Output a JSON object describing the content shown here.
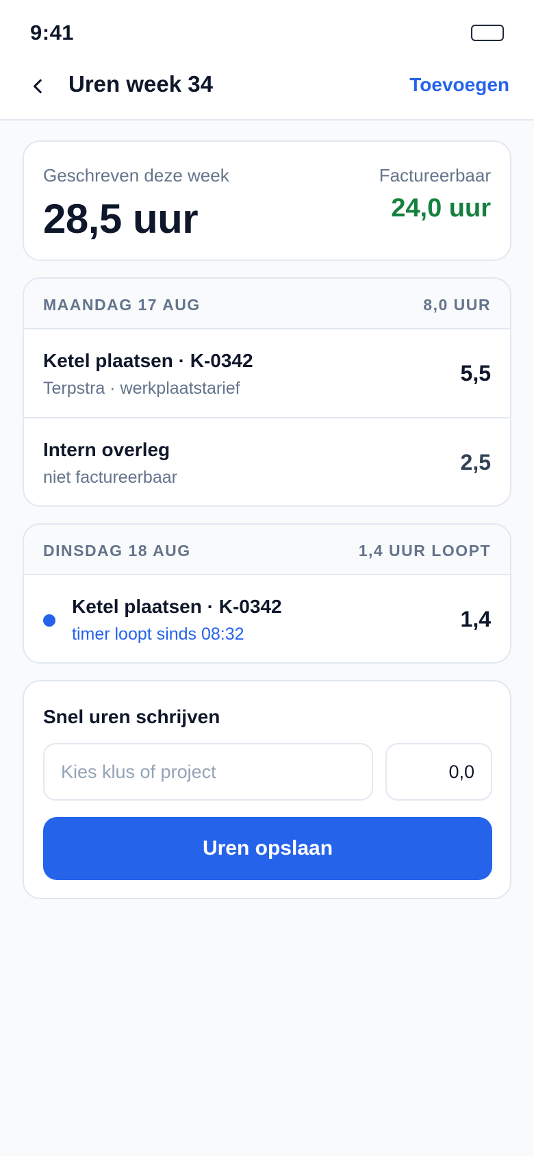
{
  "status_bar": {
    "time": "9:41",
    "battery_icon": "battery-icon"
  },
  "header": {
    "back_icon": "chevron-left-icon",
    "title": "Uren week 34",
    "action_label": "Toevoegen"
  },
  "summary": {
    "written_label": "Geschreven deze week",
    "written_value": "28,5 uur",
    "billable_label": "Factureerbaar",
    "billable_value": "24,0 uur"
  },
  "days": [
    {
      "name": "MAANDAG 17 AUG",
      "total": "8,0 UUR",
      "entries": [
        {
          "title": "Ketel plaatsen · K-0342",
          "subtitle": "Terpstra · werkplaatstarief",
          "hours": "5,5"
        },
        {
          "title": "Intern overleg",
          "subtitle": "niet factureerbaar",
          "hours": "2,5"
        }
      ]
    },
    {
      "name": "DINSDAG 18 AUG",
      "total": "1,4 UUR LOOPT",
      "entries": [
        {
          "title": "Ketel plaatsen · K-0342",
          "subtitle": "timer loopt sinds 08:32",
          "hours": "1,4",
          "running": true
        }
      ]
    }
  ],
  "quick_entry": {
    "title": "Snel uren schrijven",
    "project_placeholder": "Kies klus of project",
    "project_value": "",
    "hours_value": "0,0",
    "save_label": "Uren opslaan"
  },
  "colors": {
    "accent": "#2563eb",
    "billable": "#15803d",
    "muted": "#64748b",
    "background": "#f8fafc"
  }
}
